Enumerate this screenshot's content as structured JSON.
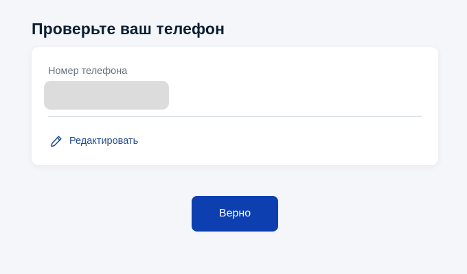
{
  "header": {
    "title": "Проверьте ваш телефон"
  },
  "phone_card": {
    "label": "Номер телефона",
    "edit_label": "Редактировать",
    "edit_icon": "pencil-icon"
  },
  "actions": {
    "confirm_label": "Верно"
  },
  "colors": {
    "primary": "#0d3fb0",
    "link": "#1d4b8f",
    "title": "#0b1f33",
    "background": "#f4f6fa"
  }
}
